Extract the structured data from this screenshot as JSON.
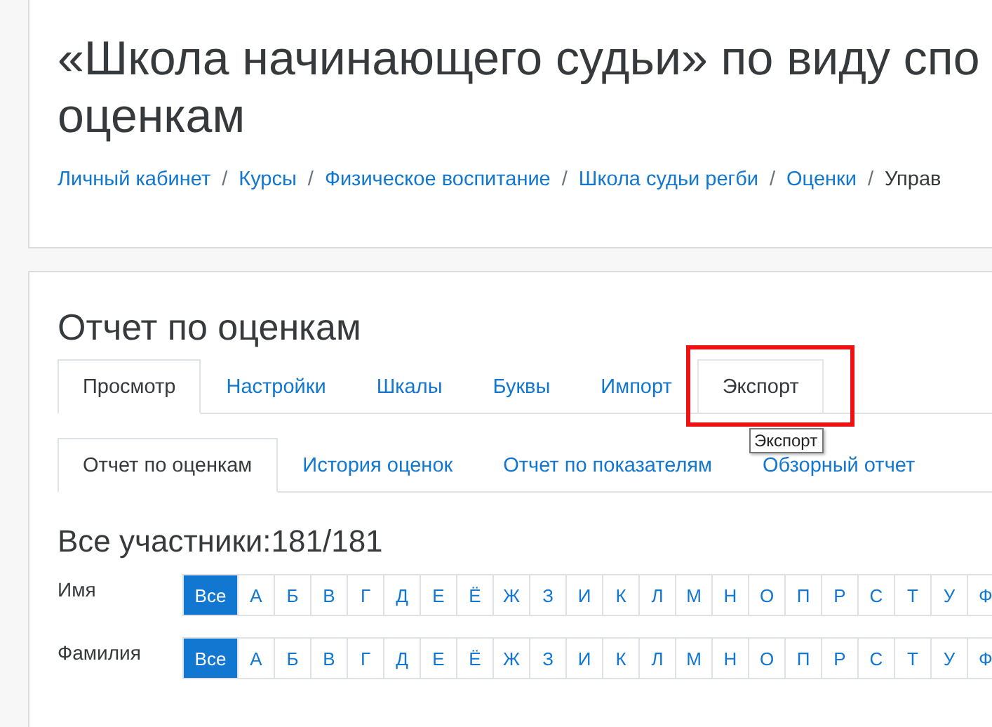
{
  "header": {
    "title_lines": [
      "«Школа начинающего судьи» по виду спо",
      "оценкам"
    ],
    "breadcrumbs": [
      {
        "label": "Личный кабинет",
        "link": true
      },
      {
        "label": "Курсы",
        "link": true,
        "separator": "/"
      },
      {
        "label": "Физическое воспитание",
        "link": true,
        "separator": "/"
      },
      {
        "label": "Школа судьи регби",
        "link": true,
        "separator": "/"
      },
      {
        "label": "Оценки",
        "link": true,
        "separator": "/"
      },
      {
        "label": "Управ",
        "link": false,
        "separator": "/"
      }
    ]
  },
  "report": {
    "heading": "Отчет по оценкам",
    "tabs": [
      {
        "label": "Просмотр",
        "selected": true
      },
      {
        "label": "Настройки",
        "selected": false
      },
      {
        "label": "Шкалы",
        "selected": false
      },
      {
        "label": "Буквы",
        "selected": false
      },
      {
        "label": "Импорт",
        "selected": false
      },
      {
        "label": "Экспорт",
        "selected": false,
        "highlighted": true
      }
    ],
    "subtabs": [
      {
        "label": "Отчет по оценкам",
        "selected": true
      },
      {
        "label": "История оценок",
        "selected": false
      },
      {
        "label": "Отчет по показателям",
        "selected": false
      },
      {
        "label": "Обзорный отчет",
        "selected": false
      }
    ],
    "tooltip": "Экспорт",
    "participants": "Все участники:181/181",
    "filters": [
      {
        "label": "Имя",
        "letters": [
          {
            "label": "Все",
            "selected": true
          },
          {
            "label": "А",
            "selected": false
          },
          {
            "label": "Б",
            "selected": false
          },
          {
            "label": "В",
            "selected": false
          },
          {
            "label": "Г",
            "selected": false
          },
          {
            "label": "Д",
            "selected": false
          },
          {
            "label": "Е",
            "selected": false
          },
          {
            "label": "Ё",
            "selected": false
          },
          {
            "label": "Ж",
            "selected": false
          },
          {
            "label": "З",
            "selected": false
          },
          {
            "label": "И",
            "selected": false
          },
          {
            "label": "К",
            "selected": false
          },
          {
            "label": "Л",
            "selected": false
          },
          {
            "label": "М",
            "selected": false
          },
          {
            "label": "Н",
            "selected": false
          },
          {
            "label": "О",
            "selected": false
          },
          {
            "label": "П",
            "selected": false
          },
          {
            "label": "Р",
            "selected": false
          },
          {
            "label": "С",
            "selected": false
          },
          {
            "label": "Т",
            "selected": false
          },
          {
            "label": "У",
            "selected": false
          },
          {
            "label": "Ф",
            "selected": false
          }
        ]
      },
      {
        "label": "Фамилия",
        "letters": [
          {
            "label": "Все",
            "selected": true
          },
          {
            "label": "А",
            "selected": false
          },
          {
            "label": "Б",
            "selected": false
          },
          {
            "label": "В",
            "selected": false
          },
          {
            "label": "Г",
            "selected": false
          },
          {
            "label": "Д",
            "selected": false
          },
          {
            "label": "Е",
            "selected": false
          },
          {
            "label": "Ё",
            "selected": false
          },
          {
            "label": "Ж",
            "selected": false
          },
          {
            "label": "З",
            "selected": false
          },
          {
            "label": "И",
            "selected": false
          },
          {
            "label": "К",
            "selected": false
          },
          {
            "label": "Л",
            "selected": false
          },
          {
            "label": "М",
            "selected": false
          },
          {
            "label": "Н",
            "selected": false
          },
          {
            "label": "О",
            "selected": false
          },
          {
            "label": "П",
            "selected": false
          },
          {
            "label": "Р",
            "selected": false
          },
          {
            "label": "С",
            "selected": false
          },
          {
            "label": "Т",
            "selected": false
          },
          {
            "label": "У",
            "selected": false
          },
          {
            "label": "Ф",
            "selected": false
          }
        ]
      }
    ]
  }
}
